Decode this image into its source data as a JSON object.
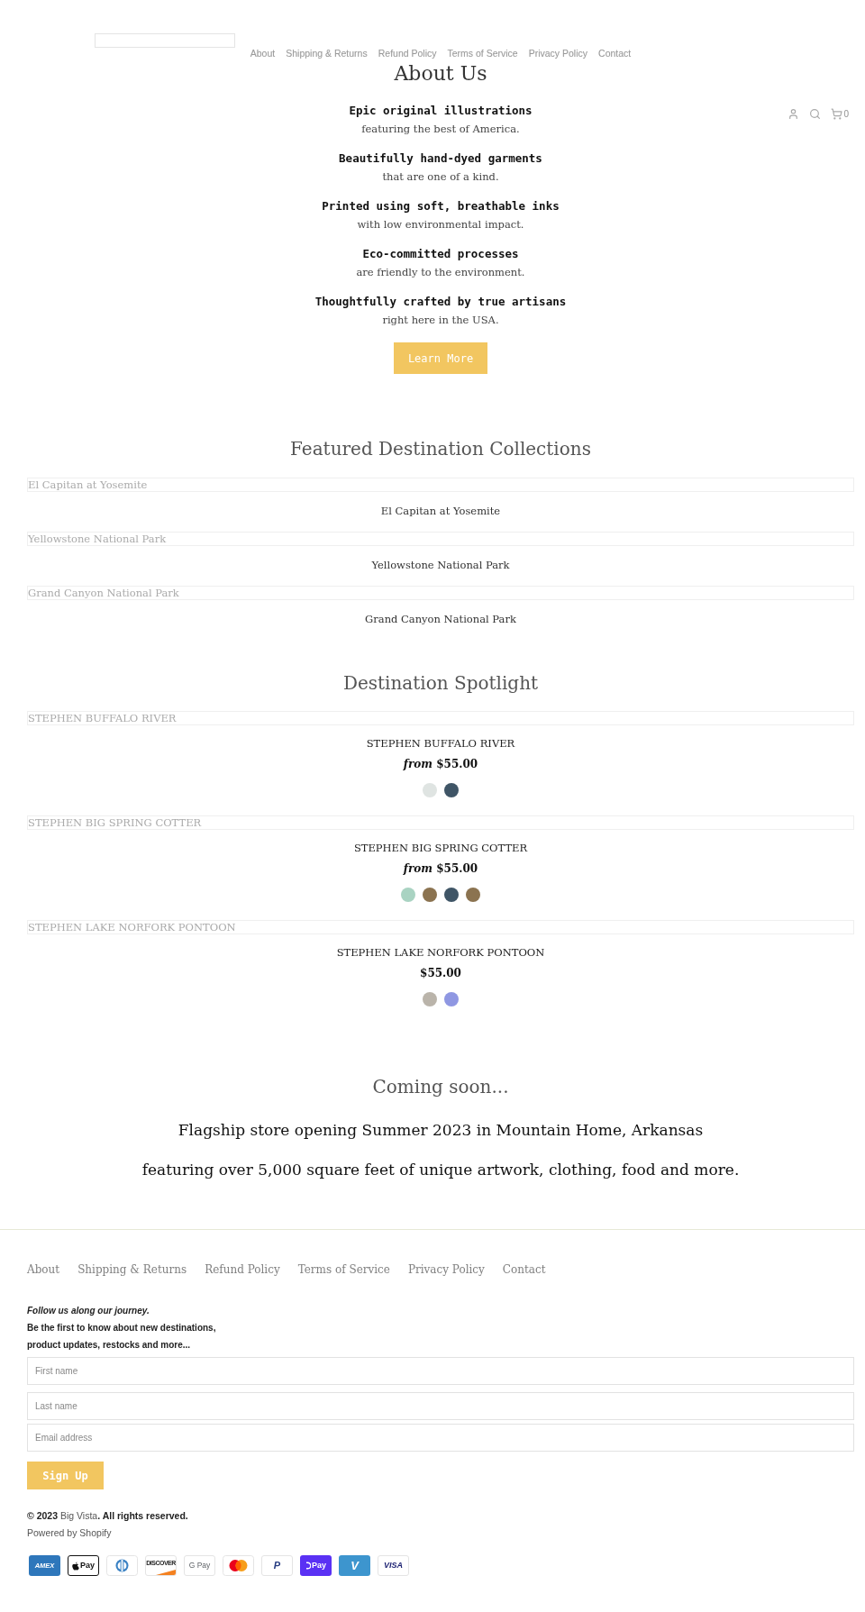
{
  "header": {
    "nav": [
      {
        "label": "About"
      },
      {
        "label": "Shipping & Returns"
      },
      {
        "label": "Refund Policy"
      },
      {
        "label": "Terms of Service"
      },
      {
        "label": "Privacy Policy"
      },
      {
        "label": "Contact"
      }
    ],
    "cart_count": "0"
  },
  "about": {
    "title": "About Us",
    "features": [
      {
        "headline": "Epic original illustrations",
        "text": "featuring the best of America."
      },
      {
        "headline": "Beautifully hand-dyed garments",
        "text": "that are one of a kind."
      },
      {
        "headline": "Printed using soft, breathable inks",
        "text": "with low environmental impact."
      },
      {
        "headline": "Eco-committed processes",
        "text": "are friendly to the environment."
      },
      {
        "headline": "Thoughtfully crafted by true artisans",
        "text": "right here in the USA."
      }
    ],
    "button": "Learn More"
  },
  "featured_collections": {
    "title": "Featured Destination Collections",
    "items": [
      {
        "image_alt": "El Capitan at Yosemite",
        "title": "El Capitan at Yosemite"
      },
      {
        "image_alt": "Yellowstone National Park",
        "title": "Yellowstone National Park"
      },
      {
        "image_alt": "Grand Canyon National Park",
        "title": "Grand Canyon National Park"
      }
    ]
  },
  "spotlight": {
    "title": "Destination Spotlight",
    "products": [
      {
        "image_alt": "STEPHEN BUFFALO RIVER",
        "title": "STEPHEN BUFFALO RIVER",
        "price": "*from* $55.00",
        "swatches": [
          {
            "color": "#dfe4e2"
          },
          {
            "color": "#3f5566"
          }
        ]
      },
      {
        "image_alt": "STEPHEN BIG SPRING COTTER",
        "title": "STEPHEN BIG SPRING COTTER",
        "price": "*from* $55.00",
        "swatches": [
          {
            "color": "#a9d3c2"
          },
          {
            "color": "#8b7350"
          },
          {
            "color": "#3f5566"
          },
          {
            "color": "#8b7350"
          }
        ]
      },
      {
        "image_alt": "STEPHEN LAKE NORFORK PONTOON",
        "title": "STEPHEN LAKE NORFORK PONTOON",
        "price": "$55.00",
        "swatches": [
          {
            "color": "#bab4aa"
          },
          {
            "color": "#8f97e2"
          }
        ]
      }
    ]
  },
  "coming_soon": {
    "title": "Coming soon...",
    "lines": [
      "Flagship store opening Summer 2023 in Mountain Home, Arkansas",
      "featuring over 5,000 square feet of unique artwork, clothing, food and more."
    ]
  },
  "footer": {
    "links": [
      {
        "label": "About"
      },
      {
        "label": "Shipping & Returns"
      },
      {
        "label": "Refund Policy"
      },
      {
        "label": "Terms of Service"
      },
      {
        "label": "Privacy Policy"
      },
      {
        "label": "Contact"
      }
    ],
    "newsletter": {
      "heading": "Follow us along our journey.",
      "lines": [
        "Be the first to know about new destinations,",
        "product updates, restocks and more..."
      ]
    },
    "fields": [
      {
        "placeholder": "First name"
      },
      {
        "placeholder": "Last name"
      },
      {
        "placeholder": "Email address"
      }
    ],
    "button": "Sign Up",
    "copyright": {
      "prefix": "© 2023 ",
      "link": "Big Vista",
      "suffix": ". All rights reserved."
    },
    "powered_by": "Powered by Shopify",
    "payment_methods": [
      {
        "kind": "amex",
        "label": "AMEX"
      },
      {
        "kind": "apple_pay",
        "label": "Pay"
      },
      {
        "kind": "diners"
      },
      {
        "kind": "discover",
        "label": "DISCOVER"
      },
      {
        "kind": "google_pay",
        "label": "G Pay"
      },
      {
        "kind": "mastercard"
      },
      {
        "kind": "paypal",
        "label": "P"
      },
      {
        "kind": "shop_pay",
        "label": "Pay"
      },
      {
        "kind": "venmo",
        "label": "V"
      },
      {
        "kind": "visa",
        "label": "VISA"
      }
    ]
  }
}
